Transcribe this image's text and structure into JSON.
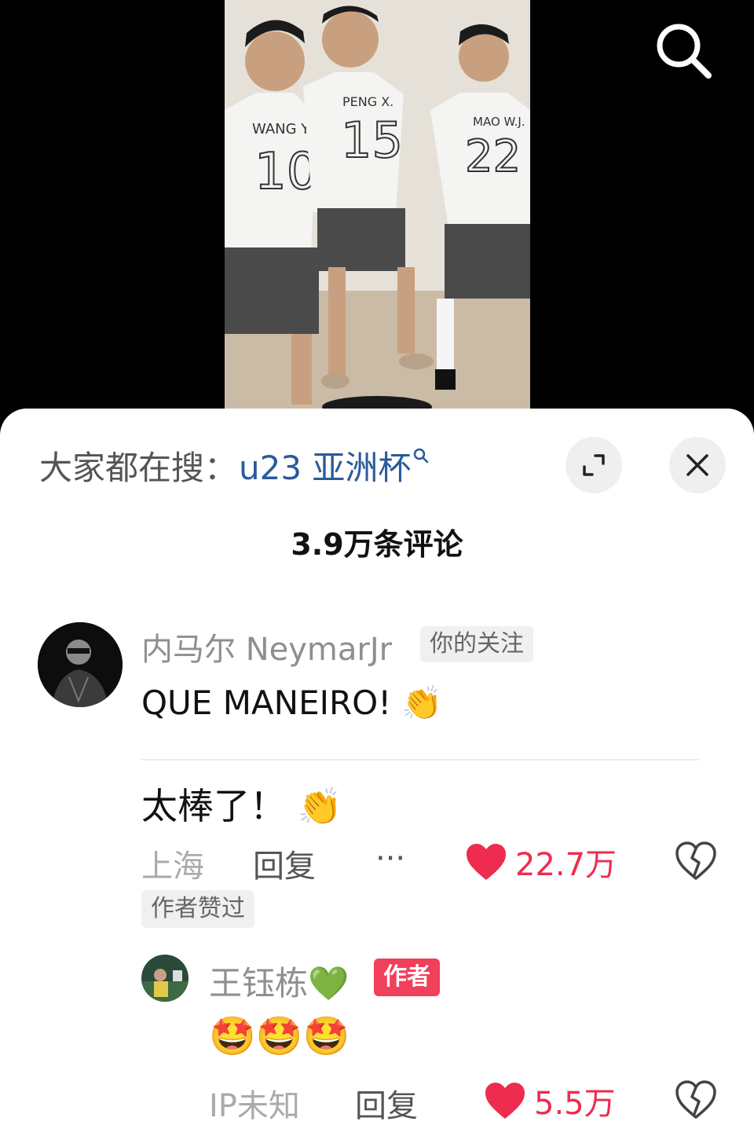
{
  "search": {
    "icon": "search-icon"
  },
  "hot_search": {
    "label": "大家都在搜：",
    "keyword": "u23 亚洲杯"
  },
  "header": {
    "comment_count": "3.9万条评论",
    "expand_icon": "expand-icon",
    "close_icon": "close-icon"
  },
  "comments": [
    {
      "author": "内马尔 NeymarJr",
      "follow_tag": "你的关注",
      "text": "QUE MANEIRO! 👏",
      "translation": "太棒了！ 👏",
      "location": "上海",
      "reply": "回复",
      "more": "···",
      "likes": "22.7万",
      "liked_by_author": "作者赞过",
      "reply_item": {
        "author": "王钰栋",
        "emoji": "💚",
        "badge": "作者",
        "text": "🤩🤩🤩",
        "location": "IP未知",
        "reply": "回复",
        "likes": "5.5万"
      }
    }
  ],
  "colors": {
    "like_red": "#ee2c4f",
    "badge_red": "#f0405a",
    "keyword_blue": "#2a5a9c"
  }
}
